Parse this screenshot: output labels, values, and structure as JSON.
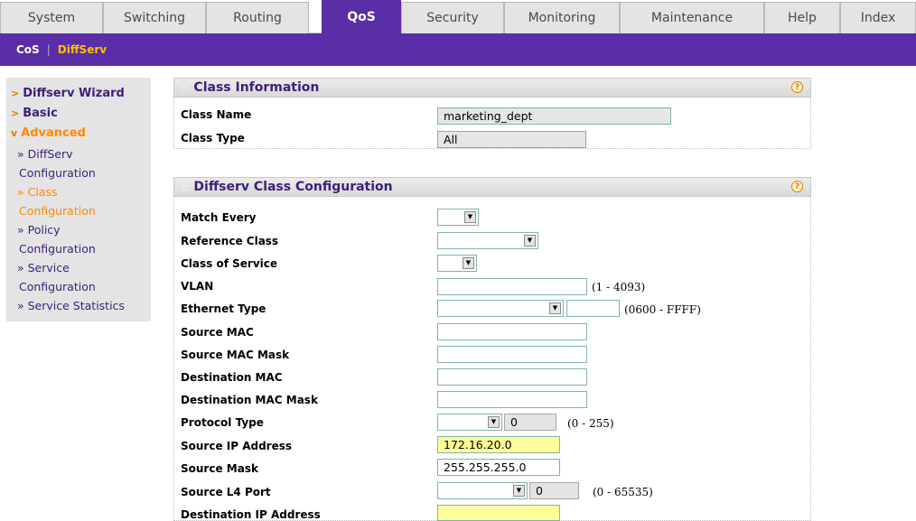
{
  "tabs": [
    {
      "label": "System"
    },
    {
      "label": "Switching"
    },
    {
      "label": "Routing"
    },
    {
      "label": "QoS",
      "active": true
    },
    {
      "label": "Security"
    },
    {
      "label": "Monitoring"
    },
    {
      "label": "Maintenance"
    },
    {
      "label": "Help"
    },
    {
      "label": "Index"
    }
  ],
  "subnav": {
    "cos": "CoS",
    "separator": "|",
    "diffserv": "DiffServ"
  },
  "leftnav": {
    "wizard": "Diffserv Wizard",
    "basic": "Basic",
    "advanced": "Advanced",
    "items": [
      {
        "line1": "» DiffServ",
        "line2": "Configuration"
      },
      {
        "line1": "» Class",
        "line2": "Configuration"
      },
      {
        "line1": "» Policy",
        "line2": "Configuration"
      },
      {
        "line1": "» Service",
        "line2": "Configuration"
      },
      {
        "line1": "» Service Statistics"
      }
    ]
  },
  "class_info": {
    "title": "Class Information",
    "class_name_label": "Class Name",
    "class_name_value": "marketing_dept",
    "class_type_label": "Class Type",
    "class_type_value": "All"
  },
  "class_config": {
    "title": "Diffserv Class Configuration",
    "match_every": "Match Every",
    "reference_class": "Reference Class",
    "class_of_service": "Class of Service",
    "vlan": "VLAN",
    "vlan_range": "(1 - 4093)",
    "ethernet_type": "Ethernet Type",
    "ethernet_range": "(0600 - FFFF)",
    "source_mac": "Source MAC",
    "source_mac_mask": "Source MAC Mask",
    "destination_mac": "Destination MAC",
    "destination_mac_mask": "Destination MAC Mask",
    "protocol_type": "Protocol Type",
    "protocol_value": "0",
    "protocol_range": "(0 - 255)",
    "source_ip": "Source IP Address",
    "source_ip_value": "172.16.20.0",
    "source_mask": "Source Mask",
    "source_mask_value": "255.255.255.0",
    "source_l4_port": "Source L4 Port",
    "source_l4_value": "0",
    "source_l4_range": "(0 - 65535)",
    "destination_ip": "Destination IP Address"
  },
  "icons": {
    "help": "help-icon",
    "dropdown": "dropdown-arrow-icon"
  }
}
